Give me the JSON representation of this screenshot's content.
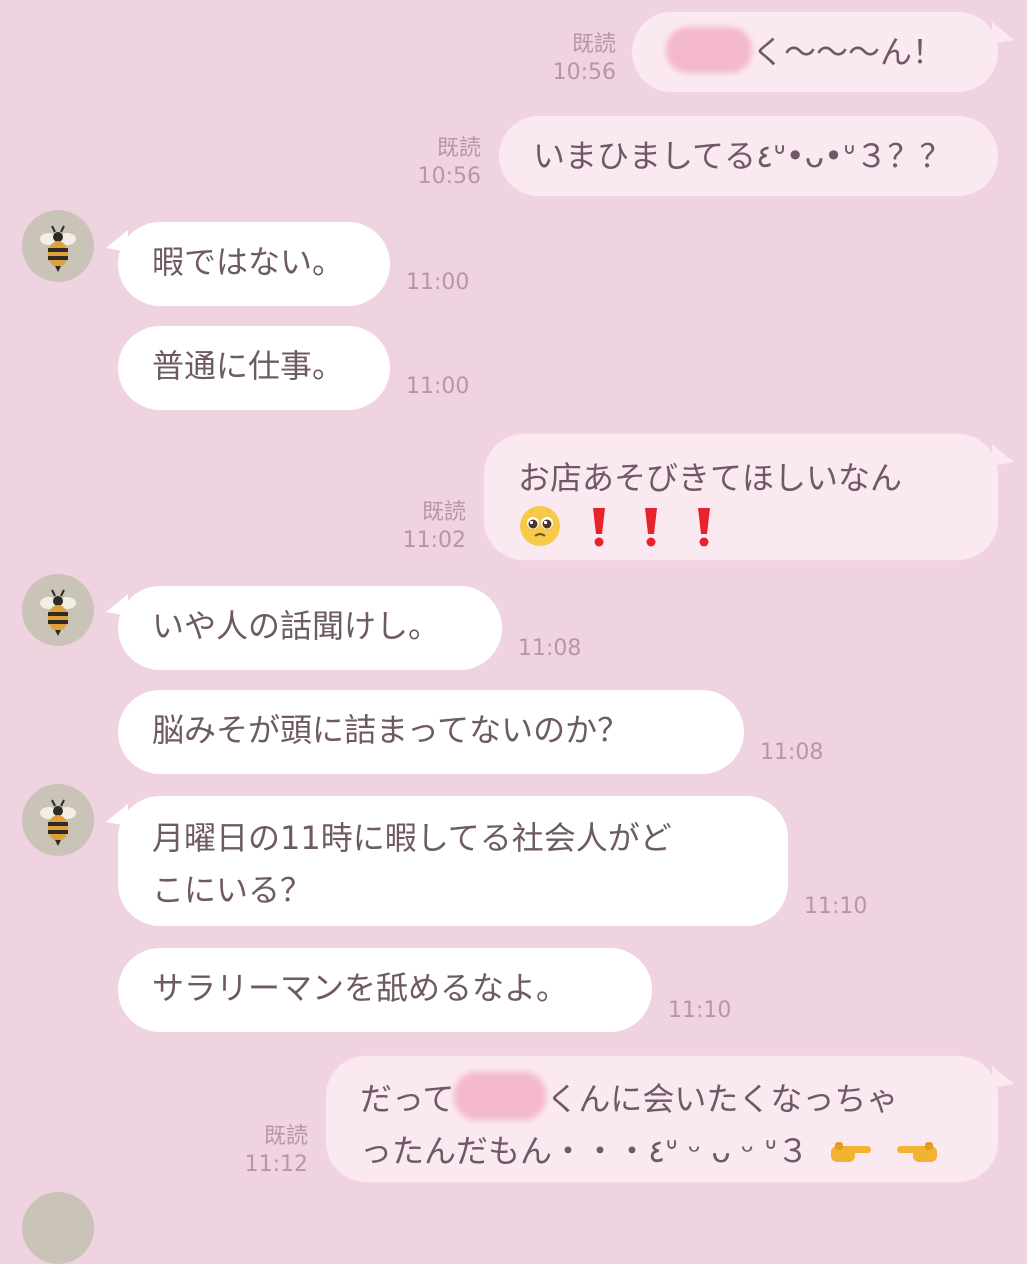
{
  "read_label": "既読",
  "messages": [
    {
      "dir": "out",
      "time": "10:56",
      "prefix_redacted": true,
      "text": "く〜〜〜ん！"
    },
    {
      "dir": "out",
      "time": "10:56",
      "text": "いまひましてる٤ᐡ•ᴗ•ᐡ３？？"
    },
    {
      "dir": "in",
      "time": "11:00",
      "text": "暇ではない。"
    },
    {
      "dir": "in",
      "time": "11:00",
      "text": "普通に仕事。"
    },
    {
      "dir": "out",
      "time": "11:02",
      "text": "お店あそびきてほしいなん",
      "emojis": [
        "pleading-face",
        "red-exclamation",
        "red-exclamation",
        "red-exclamation"
      ]
    },
    {
      "dir": "in",
      "time": "11:08",
      "text": "いや人の話聞けし。"
    },
    {
      "dir": "in",
      "time": "11:08",
      "text": "脳みそが頭に詰まってないのか？"
    },
    {
      "dir": "in",
      "time": "11:10",
      "line1": "月曜日の11時に暇してる社会人がど",
      "line2": "こにいる？"
    },
    {
      "dir": "in",
      "time": "11:10",
      "text": "サラリーマンを舐めるなよ。"
    },
    {
      "dir": "out",
      "time": "11:12",
      "line1_prefix": "だって",
      "line1_suffix": "くんに会いたくなっちゃ",
      "line2": "ったんだもん・・・٤ᐡ ᵕ ᴗ ᵕ ᐡ３",
      "emojis": [
        "pointing-right",
        "pointing-left"
      ]
    }
  ],
  "colors": {
    "background": "#efd3e0",
    "incoming": "#ffffff",
    "outgoing": "#fbe9f1",
    "text": "#6e5a64",
    "meta": "#b697a6"
  }
}
